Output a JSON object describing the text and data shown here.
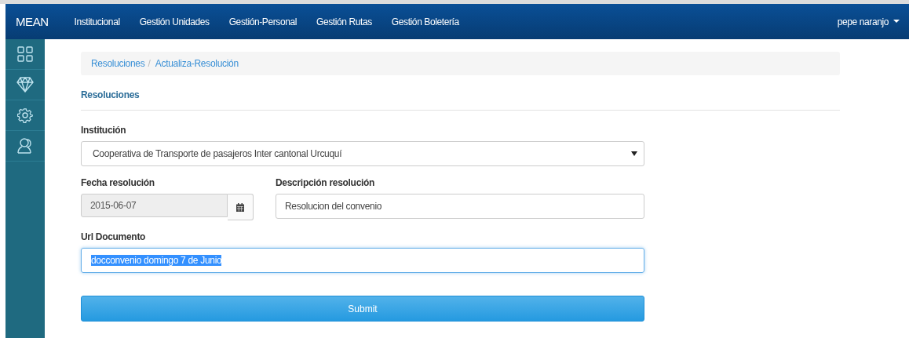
{
  "navbar": {
    "brand": "MEAN",
    "items": [
      "Institucional",
      "Gestión Unidades",
      "Gestión-Personal",
      "Gestión Rutas",
      "Gestión Boletería"
    ],
    "user": "pepe naranjo"
  },
  "sidebar": {
    "icons": [
      {
        "kind": "grid"
      },
      {
        "kind": "diamond"
      },
      {
        "kind": "gear"
      },
      {
        "kind": "user"
      }
    ]
  },
  "breadcrumb": {
    "items": [
      "Resoluciones",
      "Actualiza-Resolución"
    ],
    "separator": "/"
  },
  "section_title": "Resoluciones",
  "form": {
    "institucion": {
      "label": "Institución",
      "value": "Cooperativa de Transporte de pasajeros Inter cantonal Urcuquí"
    },
    "fecha": {
      "label": "Fecha resolución",
      "value": "2015-06-07",
      "disabled": true
    },
    "descripcion": {
      "label": "Descripción resolución",
      "value": "Resolucion del convenio"
    },
    "url": {
      "label": "Url Documento",
      "value": "docconvenio domingo 7 de Junio",
      "focused": true,
      "text_selected": true
    },
    "submit": "Submit"
  }
}
